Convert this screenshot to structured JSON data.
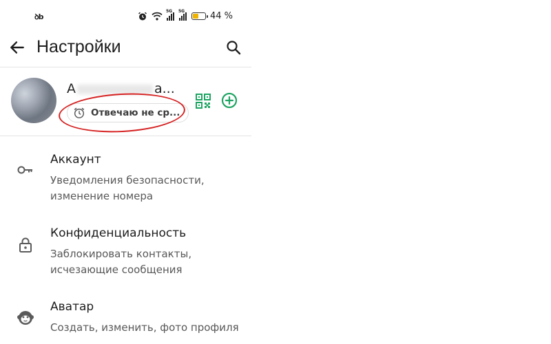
{
  "status_bar": {
    "carrier_glyph": "ꝺb",
    "signal_tag_1": "5G",
    "signal_tag_2": "5G",
    "battery_percent": "44 %",
    "battery_level": 0.44,
    "battery_color": "#f0b400"
  },
  "app_bar": {
    "title": "Настройки",
    "back_icon": "arrow-back-icon",
    "search_icon": "search-icon"
  },
  "profile": {
    "name_visible_start": "А",
    "name_visible_end": "а...",
    "status_text": "Отвечаю не ср...",
    "status_icon": "alarm-clock-icon",
    "qr_icon": "qr-code-icon",
    "add_icon": "add-circle-icon",
    "accent_color": "#1da462",
    "annotation_color": "#d62020"
  },
  "menu": {
    "items": [
      {
        "title": "Аккаунт",
        "subtitle": "Уведомления безопасности, изменение номера",
        "icon": "key-icon"
      },
      {
        "title": "Конфиденциальность",
        "subtitle": "Заблокировать контакты, исчезающие сообщения",
        "icon": "lock-icon"
      },
      {
        "title": "Аватар",
        "subtitle": "Создать, изменить, фото профиля",
        "icon": "avatar-face-icon"
      }
    ]
  }
}
